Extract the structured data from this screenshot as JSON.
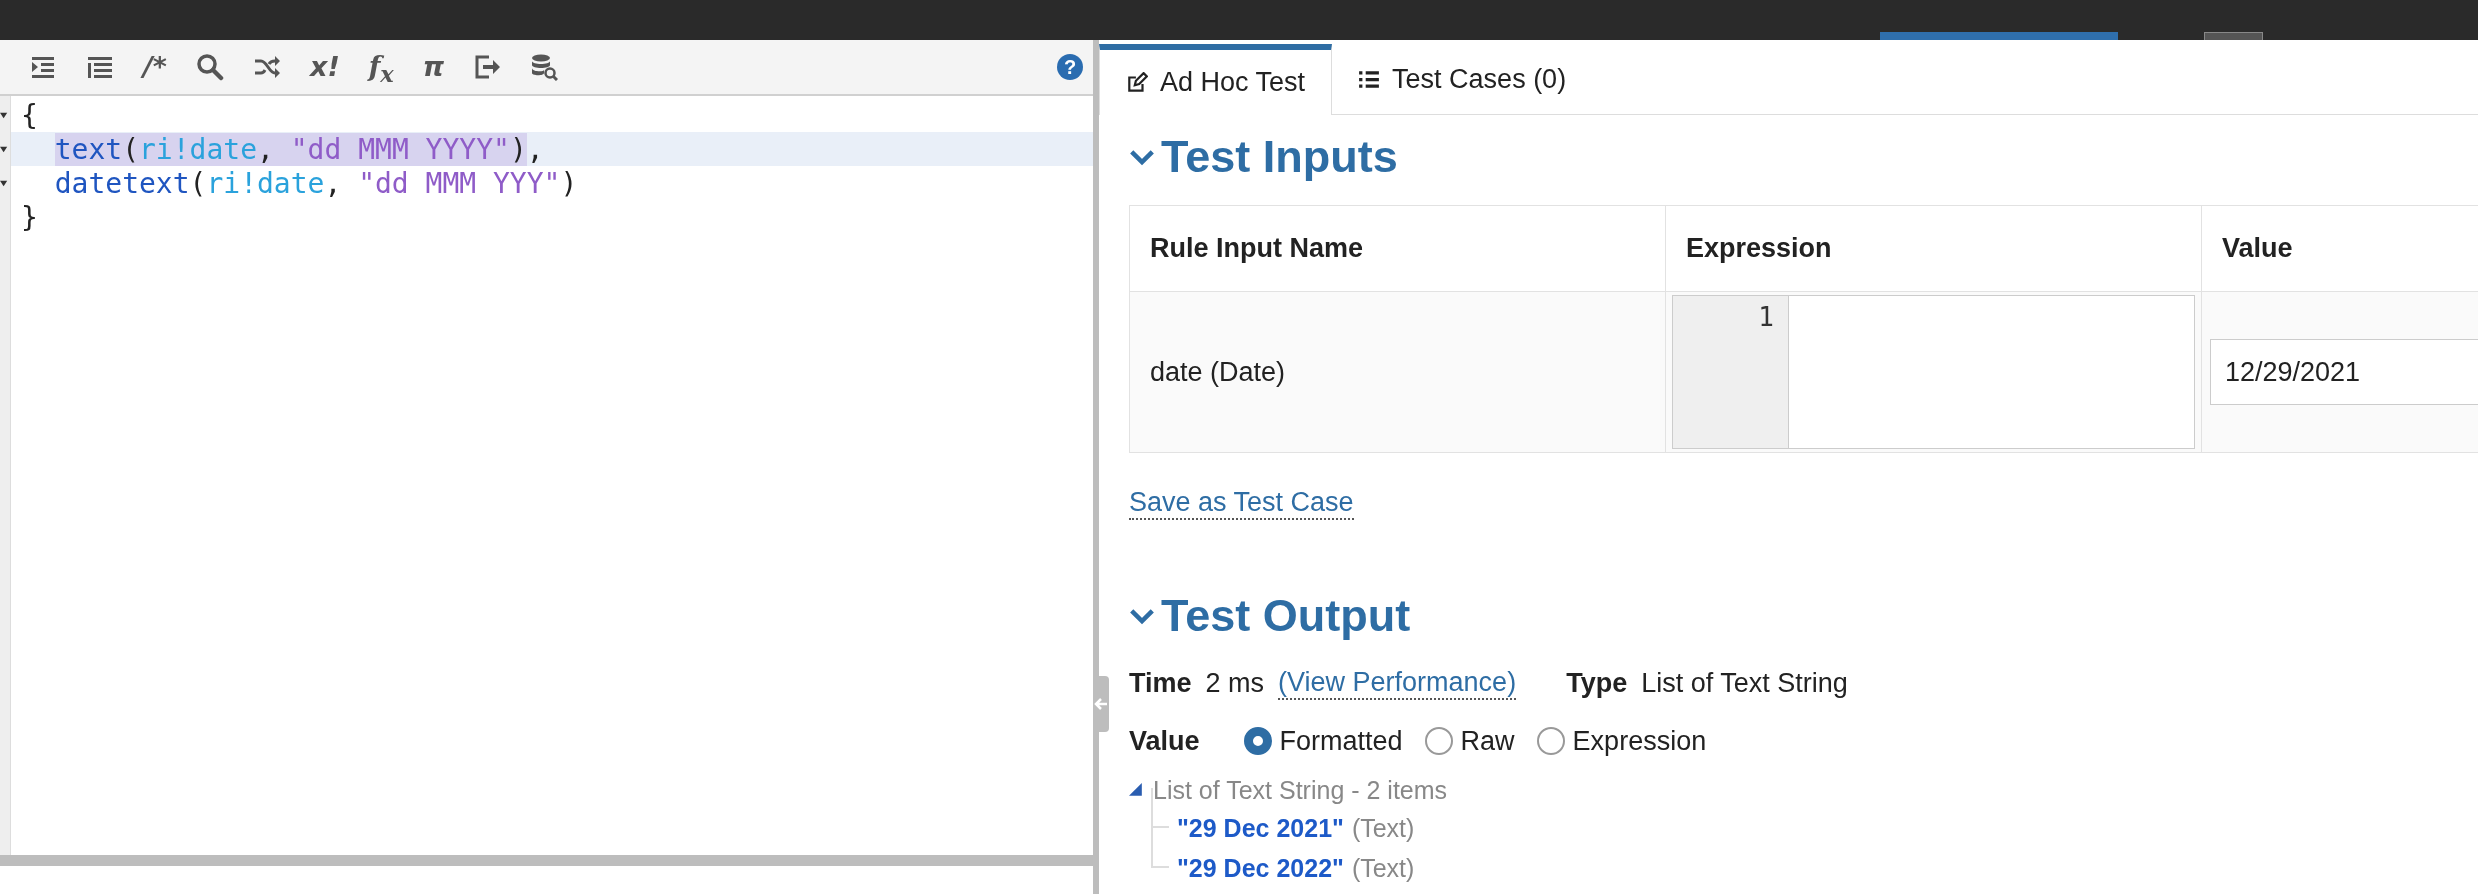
{
  "editor": {
    "toolbar": [
      {
        "kind": "indent"
      },
      {
        "kind": "lines"
      },
      {
        "kind": "glyph",
        "text": "/*"
      },
      {
        "kind": "search"
      },
      {
        "kind": "shuffle"
      },
      {
        "kind": "glyph",
        "text": "x!"
      },
      {
        "kind": "formula",
        "text": "f$_{x}$"
      },
      {
        "kind": "glyph",
        "text": "π"
      },
      {
        "kind": "exit"
      },
      {
        "kind": "database"
      }
    ],
    "help": "?",
    "lines": [
      {
        "foldable": true,
        "active": false,
        "tokens": [
          {
            "text": "{",
            "kind": "plain",
            "selected": false
          }
        ],
        "children": [
          {
            "foldable": true,
            "active": true,
            "tokens": [
              {
                "text": "text",
                "kind": "function",
                "selected": true
              },
              {
                "text": "(",
                "kind": "plain",
                "selected": true
              },
              {
                "text": "ri!date",
                "kind": "variable",
                "selected": true
              },
              {
                "text": ", ",
                "kind": "plain",
                "selected": true
              },
              {
                "text": "\"dd MMM YYYY\"",
                "kind": "string",
                "selected": true
              },
              {
                "text": ")",
                "kind": "plain",
                "selected": true
              },
              {
                "text": ",",
                "kind": "plain",
                "selected": false
              }
            ]
          },
          {
            "foldable": true,
            "active": false,
            "tokens": [
              {
                "text": "datetext",
                "kind": "function",
                "selected": false
              },
              {
                "text": "(",
                "kind": "plain",
                "selected": false
              },
              {
                "text": "ri!date",
                "kind": "variable",
                "selected": false
              },
              {
                "text": ", ",
                "kind": "plain",
                "selected": false
              },
              {
                "text": "\"dd MMM YYY\"",
                "kind": "string",
                "selected": false
              },
              {
                "text": ")",
                "kind": "plain",
                "selected": false
              }
            ]
          }
        ]
      },
      {
        "foldable": false,
        "active": false,
        "tokens": [
          {
            "text": "}",
            "kind": "plain",
            "selected": false
          }
        ]
      }
    ]
  },
  "tabs": [
    {
      "label": "Ad Hoc Test",
      "selected": true
    },
    {
      "label": "Test Cases (0)",
      "selected": false
    }
  ],
  "test_inputs": {
    "title": "Test Inputs",
    "expanded": true,
    "columns": [
      "Rule Input Name",
      "Expression",
      "Value"
    ],
    "rows": [
      {
        "name": "date (Date)",
        "line_number": "1",
        "value": "12/29/2021"
      }
    ],
    "save_link": "Save as Test Case"
  },
  "test_output": {
    "title": "Test Output",
    "expanded": true,
    "time_label": "Time",
    "time_value": "2 ms",
    "performance_link": "(View Performance)",
    "type_label": "Type",
    "type_value": "List of Text String",
    "value_label": "Value",
    "options": [
      {
        "label": "Formatted",
        "selected": true
      },
      {
        "label": "Raw",
        "selected": false
      },
      {
        "label": "Expression",
        "selected": false
      }
    ],
    "tree": {
      "label": "List of Text String - 2 items",
      "expanded": true,
      "children": [
        {
          "value": "\"29 Dec 2021\"",
          "type": "(Text)"
        },
        {
          "value": "\"29 Dec 2022\"",
          "type": "(Text)"
        }
      ]
    }
  }
}
